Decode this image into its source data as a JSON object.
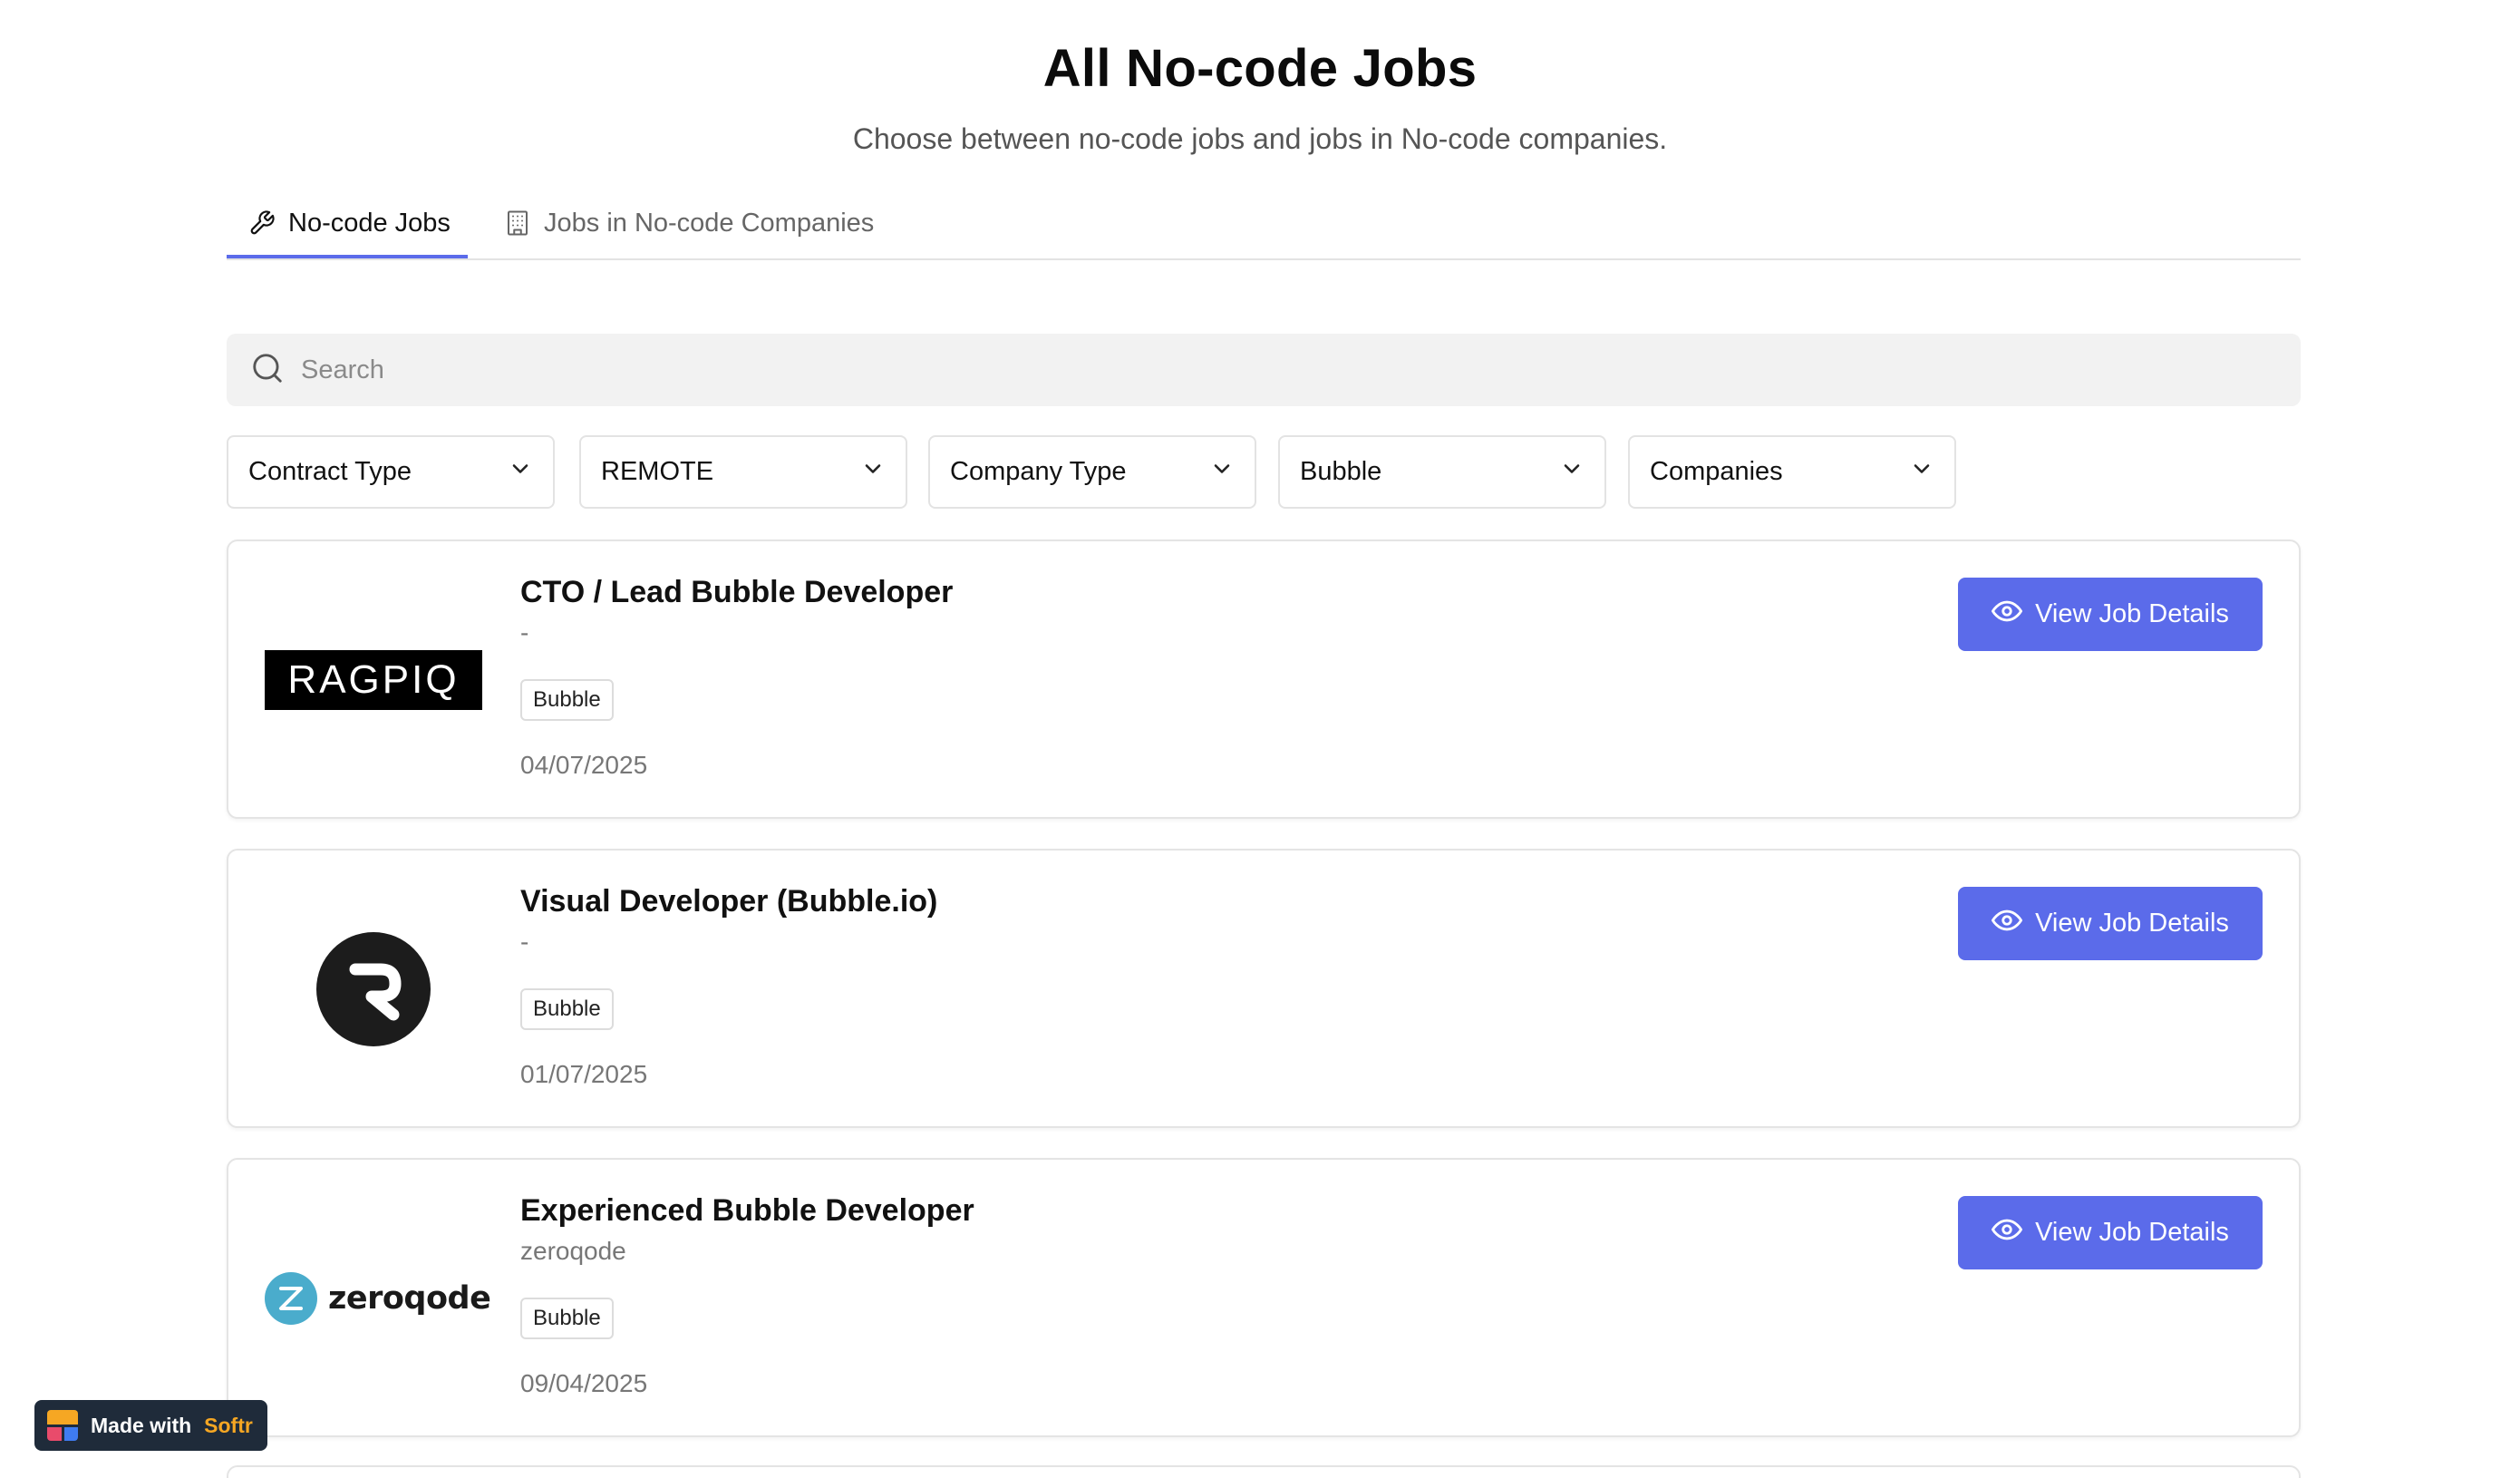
{
  "header": {
    "title": "All No-code Jobs",
    "subtitle": "Choose between no-code jobs and jobs in No-code companies."
  },
  "tabs": [
    {
      "label": "No-code Jobs",
      "icon": "wrench-icon",
      "active": true
    },
    {
      "label": "Jobs in No-code Companies",
      "icon": "building-icon",
      "active": false
    }
  ],
  "search": {
    "placeholder": "Search",
    "value": ""
  },
  "filters": [
    {
      "label": "Contract Type"
    },
    {
      "label": "REMOTE"
    },
    {
      "label": "Company Type"
    },
    {
      "label": "Bubble"
    },
    {
      "label": "Companies"
    }
  ],
  "jobs": [
    {
      "title": "CTO / Lead Bubble Developer",
      "company": "-",
      "tag": "Bubble",
      "date": "04/07/2025",
      "logo_text": "RAGPIQ",
      "button_label": "View Job Details"
    },
    {
      "title": "Visual Developer (Bubble.io)",
      "company": "-",
      "tag": "Bubble",
      "date": "01/07/2025",
      "logo_text": "",
      "button_label": "View Job Details"
    },
    {
      "title": "Experienced Bubble Developer",
      "company": "zeroqode",
      "tag": "Bubble",
      "date": "09/04/2025",
      "logo_text": "zeroqode",
      "button_label": "View Job Details"
    }
  ],
  "badge": {
    "text": "Made with",
    "brand": "Softr"
  },
  "colors": {
    "accent": "#5b6bea",
    "badge_bg": "#1f2b3a",
    "badge_brand": "#f6a723"
  }
}
